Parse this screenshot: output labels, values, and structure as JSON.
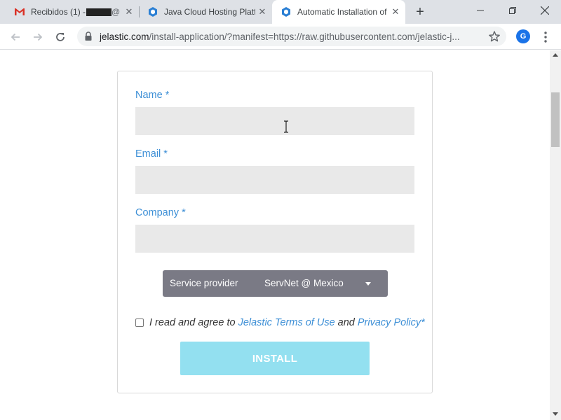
{
  "tabs": [
    {
      "title": "Recibidos (1) - ",
      "favicon": "gmail-icon",
      "active": false
    },
    {
      "title": "Java Cloud Hosting Platform",
      "favicon": "jelastic-icon",
      "active": false
    },
    {
      "title": "Automatic Installation of",
      "favicon": "jelastic-icon",
      "active": true
    }
  ],
  "toolbar": {
    "url_host": "jelastic.com",
    "url_path": "/install-application/?manifest=https://raw.githubusercontent.com/jelastic-j...",
    "avatar_letter": "G"
  },
  "form": {
    "name_label": "Name *",
    "email_label": "Email *",
    "company_label": "Company *",
    "name_value": "",
    "email_value": "",
    "company_value": "",
    "provider_label": "Service provider",
    "provider_value": "ServNet @ Mexico",
    "agree_prefix": "I read and agree to ",
    "terms_link": "Jelastic Terms of Use",
    "agree_middle": " and ",
    "privacy_link": "Privacy Policy*",
    "agree_checked": false,
    "install_label": "INSTALL"
  },
  "colors": {
    "label_blue": "#3d8fd6",
    "install_button": "#93e0f0",
    "provider_bg": "#7a7a85"
  }
}
